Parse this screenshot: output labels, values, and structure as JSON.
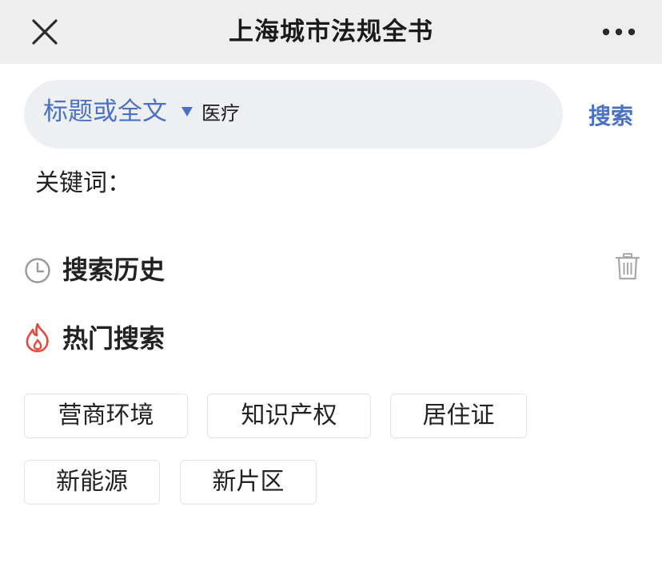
{
  "header": {
    "title": "上海城市法规全书",
    "close_icon": "close-icon",
    "more_icon": "more-dots-icon"
  },
  "search": {
    "scope_label": "标题或全文",
    "query_value": "医疗",
    "button_label": "搜索",
    "accent_color": "#4a72c4"
  },
  "keyword": {
    "label": "关键词："
  },
  "history": {
    "title": "搜索历史",
    "icon": "clock-icon",
    "delete_icon": "trash-icon"
  },
  "hot": {
    "title": "热门搜索",
    "icon": "flame-icon",
    "icon_color": "#e04a3f",
    "tags": [
      "营商环境",
      "知识产权",
      "居住证",
      "新能源",
      "新片区"
    ]
  }
}
